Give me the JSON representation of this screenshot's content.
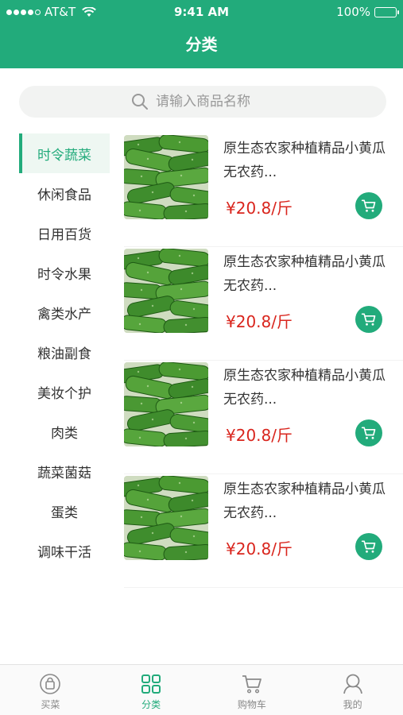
{
  "status_bar": {
    "carrier": "AT&T",
    "time": "9:41 AM",
    "battery": "100%"
  },
  "nav": {
    "title": "分类"
  },
  "search": {
    "placeholder": "请输入商品名称"
  },
  "categories": [
    "时令蔬菜",
    "休闲食品",
    "日用百货",
    "时令水果",
    "禽类水产",
    "粮油副食",
    "美妆个护",
    "肉类",
    "蔬菜菌菇",
    "蛋类",
    "调味干活"
  ],
  "active_category": 0,
  "products": [
    {
      "title": "原生态农家种植精品小黄瓜无农药...",
      "price": "¥20.8/斤"
    },
    {
      "title": "原生态农家种植精品小黄瓜无农药...",
      "price": "¥20.8/斤"
    },
    {
      "title": "原生态农家种植精品小黄瓜无农药...",
      "price": "¥20.8/斤"
    },
    {
      "title": "原生态农家种植精品小黄瓜无农药...",
      "price": "¥20.8/斤"
    }
  ],
  "tabs": [
    {
      "label": "买菜",
      "icon": "shopping-bag-icon"
    },
    {
      "label": "分类",
      "icon": "grid-icon"
    },
    {
      "label": "购物车",
      "icon": "cart-icon"
    },
    {
      "label": "我的",
      "icon": "user-icon"
    }
  ],
  "active_tab": 1,
  "colors": {
    "brand": "#22ab7b",
    "price": "#d9251d",
    "active_category_bg": "#eef7f2"
  }
}
